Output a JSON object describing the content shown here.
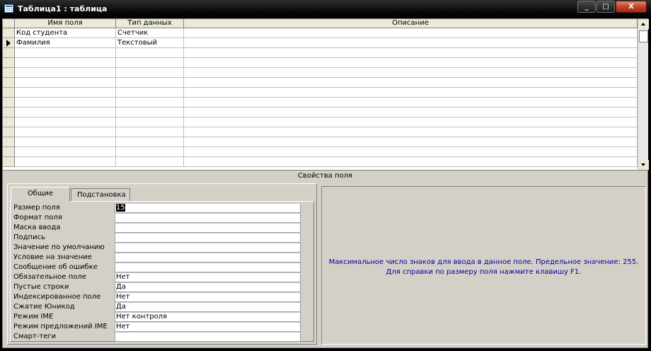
{
  "window": {
    "title": "Таблица1 : таблица",
    "buttons": {
      "minimize": "_",
      "maximize": "□",
      "close": "X"
    }
  },
  "grid": {
    "headers": [
      "Имя поля",
      "Тип данных",
      "Описание"
    ],
    "rows": [
      {
        "name": "Код студента",
        "type": "Счетчик",
        "desc": ""
      },
      {
        "name": "Фамилия",
        "type": "Текстовый",
        "desc": ""
      }
    ],
    "current_row": 2
  },
  "properties": {
    "title": "Свойства поля",
    "tabs": [
      "Общие",
      "Подстановка"
    ],
    "active_tab": "Общие",
    "rows": [
      {
        "label": "Размер поля",
        "value": "15"
      },
      {
        "label": "Формат поля",
        "value": ""
      },
      {
        "label": "Маска ввода",
        "value": ""
      },
      {
        "label": "Подпись",
        "value": ""
      },
      {
        "label": "Значение по умолчанию",
        "value": ""
      },
      {
        "label": "Условие на значение",
        "value": ""
      },
      {
        "label": "Сообщение об ошибке",
        "value": ""
      },
      {
        "label": "Обязательное поле",
        "value": "Нет"
      },
      {
        "label": "Пустые строки",
        "value": "Да"
      },
      {
        "label": "Индексированное поле",
        "value": "Нет"
      },
      {
        "label": "Сжатие Юникод",
        "value": "Да"
      },
      {
        "label": "Режим IME",
        "value": "Нет контроля"
      },
      {
        "label": "Режим предложений IME",
        "value": "Нет"
      },
      {
        "label": "Смарт-теги",
        "value": ""
      }
    ]
  },
  "help": {
    "line1": "Максимальное число знаков для ввода в данное поле.  Предельное значение: 255.",
    "line2": "Для справки по размеру поля нажмите клавишу F1."
  }
}
